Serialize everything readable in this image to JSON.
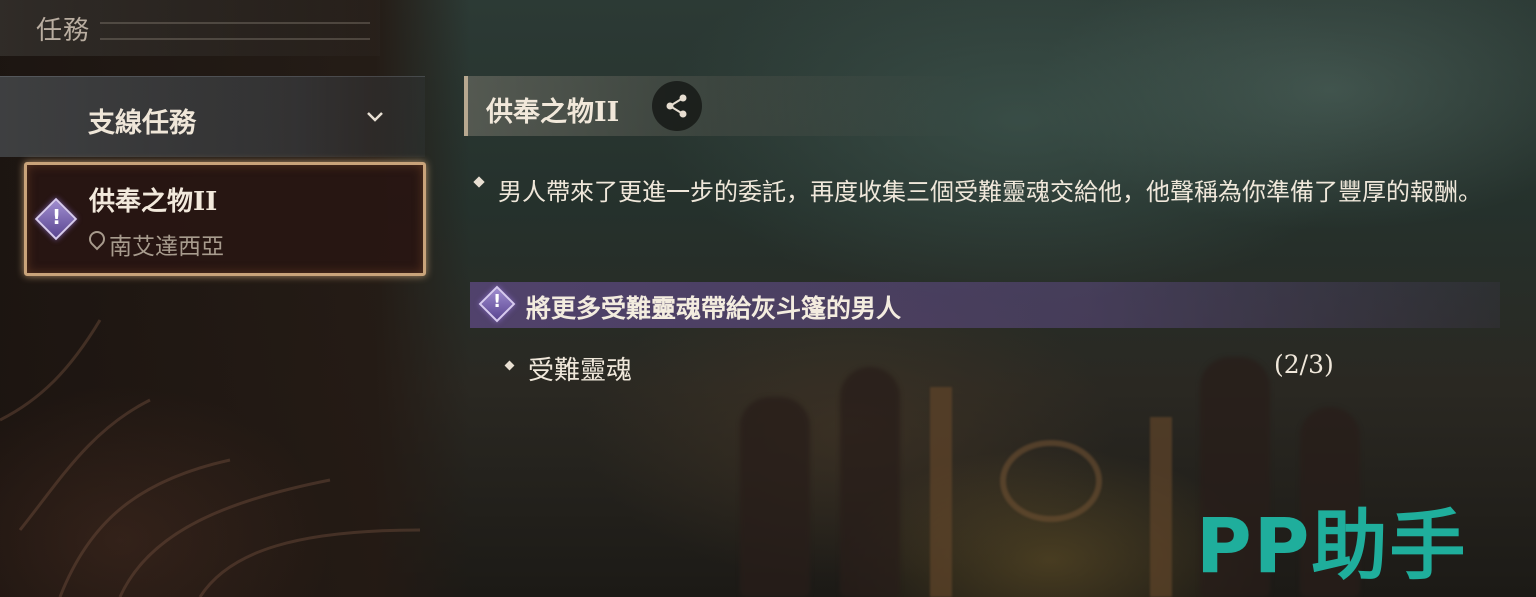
{
  "header": {
    "title": "任務"
  },
  "sidebar": {
    "category": {
      "label": "支線任務",
      "icon": "chevron-down-icon"
    },
    "quests": [
      {
        "name": "供奉之物II",
        "location": "南艾達西亞",
        "icon": "quest-alert-icon",
        "selected": true
      }
    ]
  },
  "detail": {
    "title": "供奉之物II",
    "share_icon": "share-icon",
    "description": "男人帶來了更進一步的委託，再度收集三個受難靈魂交給他，他聲稱為你準備了豐厚的報酬。",
    "objective": {
      "text": "將更多受難靈魂帶給灰斗篷的男人",
      "icon": "quest-alert-icon"
    },
    "subtasks": [
      {
        "label": "受難靈魂",
        "progress": "(2/3)"
      }
    ]
  },
  "watermark": {
    "text": "PP助手",
    "color": "#1fae9c"
  },
  "colors": {
    "objective_bar": "#58467a",
    "selected_border": "#c9a37a",
    "quest_icon": "#7a66b0"
  }
}
